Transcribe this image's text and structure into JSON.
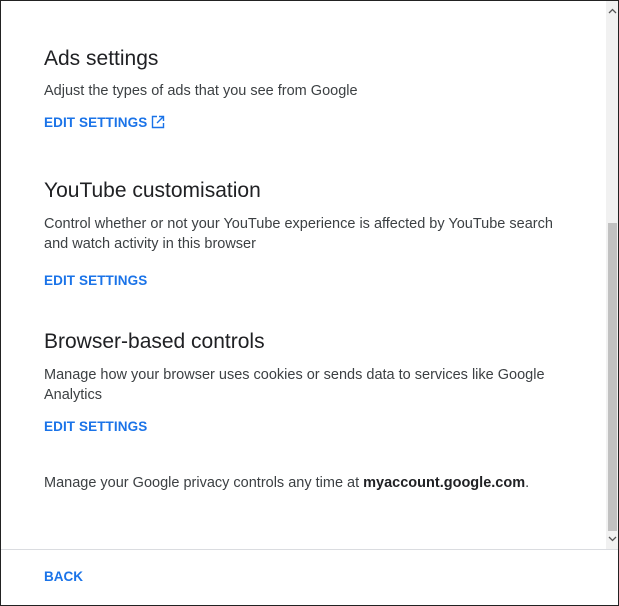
{
  "sections": [
    {
      "title": "Ads settings",
      "description": "Adjust the types of ads that you see from Google",
      "link_label": "EDIT SETTINGS",
      "link_icon": "external-link-icon"
    },
    {
      "title": "YouTube customisation",
      "description": "Control whether or not your YouTube experience is affected by YouTube search and watch activity in this browser",
      "link_label": "EDIT SETTINGS"
    },
    {
      "title": "Browser-based controls",
      "description": "Manage how your browser uses cookies or sends data to services like Google Analytics",
      "link_label": "EDIT SETTINGS"
    }
  ],
  "footer_note": {
    "prefix": "Manage your Google privacy controls any time at ",
    "link": "myaccount.google.com",
    "suffix": "."
  },
  "bottom_bar": {
    "back_label": "BACK"
  },
  "colors": {
    "link": "#1a73e8",
    "text": "#3c4043",
    "heading": "#202124"
  }
}
